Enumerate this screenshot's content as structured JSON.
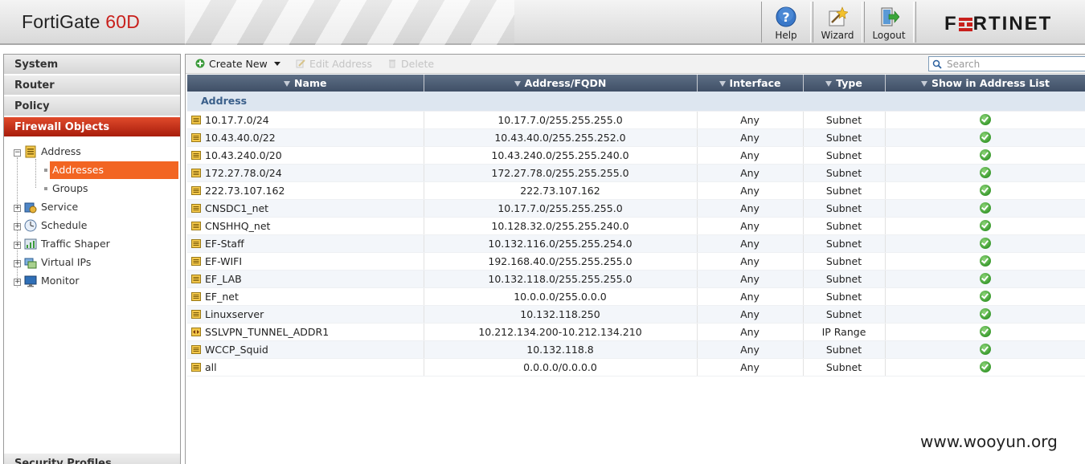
{
  "header": {
    "product_name": "FortiGate",
    "product_model": "60D",
    "buttons": [
      {
        "label": "Help",
        "icon": "help-icon"
      },
      {
        "label": "Wizard",
        "icon": "wizard-icon"
      },
      {
        "label": "Logout",
        "icon": "logout-icon"
      }
    ],
    "brand": "FORTINET"
  },
  "sidebar": {
    "sections": [
      "System",
      "Router",
      "Policy",
      "Firewall Objects"
    ],
    "active_section": "Firewall Objects",
    "tree": [
      {
        "label": "Address",
        "expanded": true,
        "children": [
          "Addresses",
          "Groups"
        ],
        "selected_child": "Addresses"
      },
      {
        "label": "Service"
      },
      {
        "label": "Schedule"
      },
      {
        "label": "Traffic Shaper"
      },
      {
        "label": "Virtual IPs"
      },
      {
        "label": "Monitor"
      }
    ],
    "bottom_section": "Security Profiles"
  },
  "toolbar": {
    "create_new": "Create New",
    "edit_address": "Edit Address",
    "delete": "Delete",
    "search_placeholder": "Search"
  },
  "table": {
    "columns": [
      "Name",
      "Address/FQDN",
      "Interface",
      "Type",
      "Show in Address List"
    ],
    "group": "Address",
    "rows": [
      {
        "name": "10.17.7.0/24",
        "address": "10.17.7.0/255.255.255.0",
        "interface": "Any",
        "type": "Subnet",
        "show": true
      },
      {
        "name": "10.43.40.0/22",
        "address": "10.43.40.0/255.255.252.0",
        "interface": "Any",
        "type": "Subnet",
        "show": true
      },
      {
        "name": "10.43.240.0/20",
        "address": "10.43.240.0/255.255.240.0",
        "interface": "Any",
        "type": "Subnet",
        "show": true
      },
      {
        "name": "172.27.78.0/24",
        "address": "172.27.78.0/255.255.255.0",
        "interface": "Any",
        "type": "Subnet",
        "show": true
      },
      {
        "name": "222.73.107.162",
        "address": "222.73.107.162",
        "interface": "Any",
        "type": "Subnet",
        "show": true
      },
      {
        "name": "CNSDC1_net",
        "address": "10.17.7.0/255.255.255.0",
        "interface": "Any",
        "type": "Subnet",
        "show": true
      },
      {
        "name": "CNSHHQ_net",
        "address": "10.128.32.0/255.255.240.0",
        "interface": "Any",
        "type": "Subnet",
        "show": true
      },
      {
        "name": "EF-Staff",
        "address": "10.132.116.0/255.255.254.0",
        "interface": "Any",
        "type": "Subnet",
        "show": true
      },
      {
        "name": "EF-WIFI",
        "address": "192.168.40.0/255.255.255.0",
        "interface": "Any",
        "type": "Subnet",
        "show": true
      },
      {
        "name": "EF_LAB",
        "address": "10.132.118.0/255.255.255.0",
        "interface": "Any",
        "type": "Subnet",
        "show": true
      },
      {
        "name": "EF_net",
        "address": "10.0.0.0/255.0.0.0",
        "interface": "Any",
        "type": "Subnet",
        "show": true
      },
      {
        "name": "Linuxserver",
        "address": "10.132.118.250",
        "interface": "Any",
        "type": "Subnet",
        "show": true
      },
      {
        "name": "SSLVPN_TUNNEL_ADDR1",
        "address": "10.212.134.200-10.212.134.210",
        "interface": "Any",
        "type": "IP Range",
        "show": true
      },
      {
        "name": "WCCP_Squid",
        "address": "10.132.118.8",
        "interface": "Any",
        "type": "Subnet",
        "show": true
      },
      {
        "name": "all",
        "address": "0.0.0.0/0.0.0.0",
        "interface": "Any",
        "type": "Subnet",
        "show": true
      }
    ]
  },
  "watermark": "www.wooyun.org"
}
